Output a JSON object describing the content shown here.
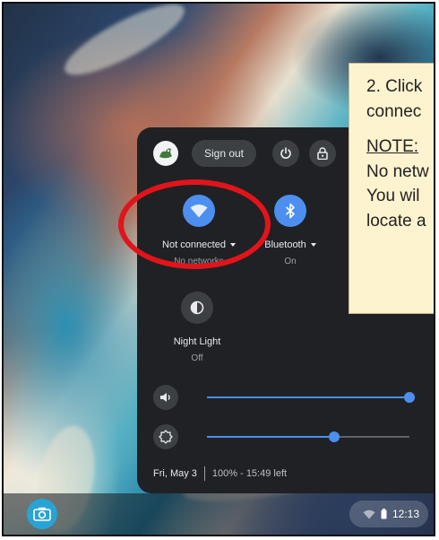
{
  "quick_settings": {
    "sign_out_label": "Sign out",
    "network": {
      "label": "Not connected",
      "status": "No networks",
      "color": "#4d8fef"
    },
    "bluetooth": {
      "label": "Bluetooth",
      "status": "On",
      "color": "#4d8fef"
    },
    "night_light": {
      "label": "Night Light",
      "status": "Off"
    },
    "volume": {
      "level_percent": 100
    },
    "brightness": {
      "level_percent": 63
    },
    "footer": {
      "date": "Fri, May 3",
      "battery": "100% - 15:49 left"
    }
  },
  "shelf": {
    "time": "12:13"
  },
  "instruction_note": {
    "lines": [
      "2. Click",
      "connec"
    ],
    "heading": "NOTE:",
    "body_lines": [
      "No netw",
      "You wil",
      "locate a"
    ]
  },
  "annotation": {
    "circle_color": "#e1141b"
  },
  "icons": [
    "avatar-icon",
    "power-icon",
    "lock-icon",
    "wifi-icon",
    "bluetooth-icon",
    "night-light-icon",
    "volume-icon",
    "brightness-icon",
    "camera-icon",
    "wifi-status-icon",
    "battery-icon"
  ]
}
